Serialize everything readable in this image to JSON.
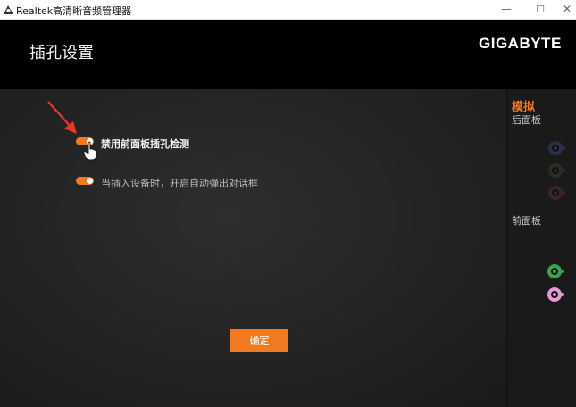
{
  "window": {
    "title": "Realtek高清晰音频管理器",
    "minimize_glyph": "—",
    "maximize_glyph": "☐",
    "close_glyph": "✕"
  },
  "header": {
    "title": "插孔设置",
    "brand": "GIGABYTE"
  },
  "options": [
    {
      "label": "禁用前面板插孔检测",
      "enabled": true
    },
    {
      "label": "当插入设备时，开启自动弹出对话框",
      "enabled": true
    }
  ],
  "ok_label": "确定",
  "side_panel": {
    "heading": "模拟",
    "rear_label": "后面板",
    "front_label": "前面板",
    "rear_jacks": [
      {
        "color": "#2a2f4a",
        "icon": "rear-jack-blue-inactive"
      },
      {
        "color": "#2a2e22",
        "icon": "rear-jack-green-inactive"
      },
      {
        "color": "#3b2430",
        "icon": "rear-jack-pink-inactive"
      }
    ],
    "front_jacks": [
      {
        "color": "#37a548",
        "icon": "front-jack-green-active"
      },
      {
        "color": "#e79ad4",
        "icon": "front-jack-pink-active"
      }
    ]
  },
  "colors": {
    "accent": "#f07a22",
    "arrow": "#e8382d"
  }
}
